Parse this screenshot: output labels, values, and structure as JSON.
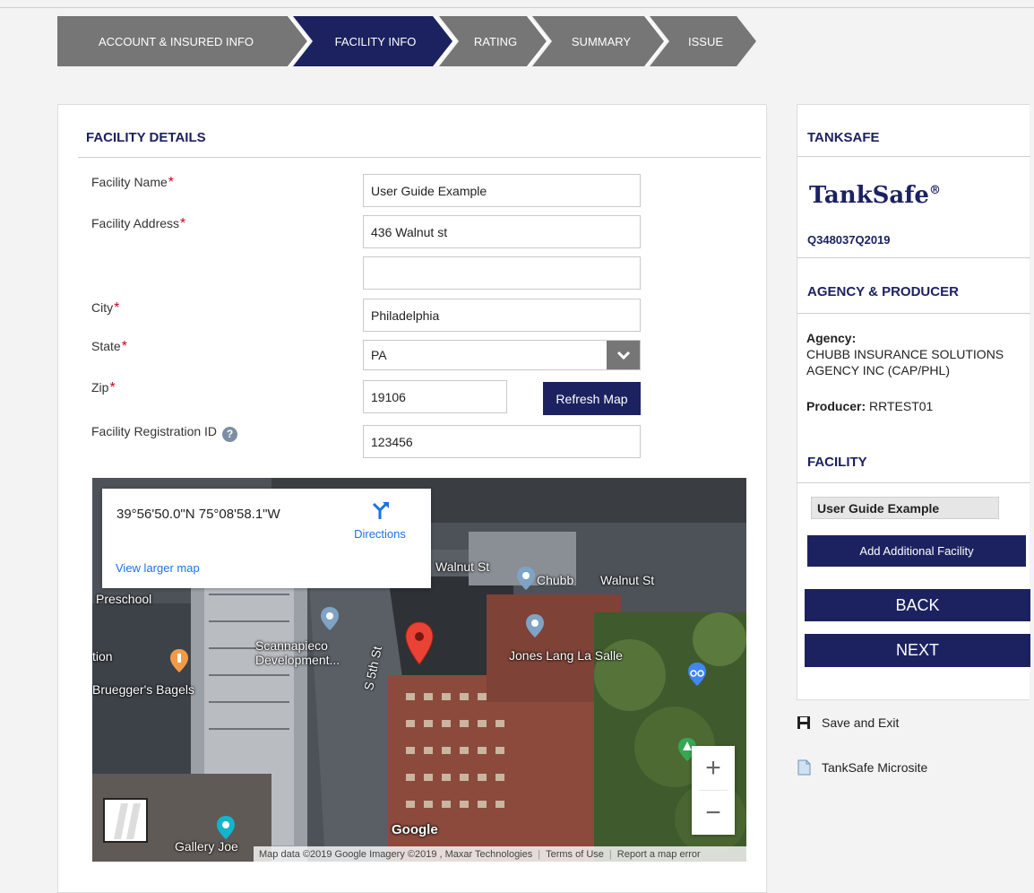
{
  "steps": [
    {
      "label": "ACCOUNT & INSURED INFO",
      "active": false
    },
    {
      "label": "FACILITY INFO",
      "active": true
    },
    {
      "label": "RATING",
      "active": false
    },
    {
      "label": "SUMMARY",
      "active": false
    },
    {
      "label": "ISSUE",
      "active": false
    }
  ],
  "facility": {
    "section_title": "FACILITY DETAILS",
    "required_mark": "*",
    "name_label": "Facility Name",
    "name_value": "User Guide Example",
    "address_label": "Facility Address",
    "address_value": "436 Walnut st",
    "address2_value": "",
    "city_label": "City",
    "city_value": "Philadelphia",
    "state_label": "State",
    "state_value": "PA",
    "zip_label": "Zip",
    "zip_value": "19106",
    "refresh_map": "Refresh Map",
    "reg_id_label": "Facility Registration ID",
    "help_glyph": "?",
    "reg_id_value": "123456"
  },
  "map": {
    "coords": "39°56'50.0\"N 75°08'58.1\"W",
    "directions": "Directions",
    "view_larger": "View larger map",
    "labels": [
      "Walnut St",
      "Chubb",
      "Walnut St",
      "Preschool",
      "Scannapieco Development...",
      "Jones Lang La Salle",
      "tion",
      "Bruegger's Bagels",
      "S 5th St",
      "Gallery Joe",
      "Google"
    ],
    "zoom_in": "+",
    "zoom_out": "−",
    "attribution": [
      "Map data ©2019 Google Imagery ©2019 , Maxar Technologies",
      "Terms of Use",
      "Report a map error"
    ]
  },
  "sidebar": {
    "tanksafe_title": "TANKSAFE",
    "logo_text": "TankSafe",
    "logo_mark": "®",
    "quote_number": "Q348037Q2019",
    "agency_title": "AGENCY & PRODUCER",
    "agency_label": "Agency:",
    "agency_name": "CHUBB INSURANCE SOLUTIONS AGENCY INC (CAP/PHL)",
    "producer_label": "Producer:",
    "producer_value": "RRTEST01",
    "facility_title": "FACILITY",
    "facility_item": "User Guide Example",
    "add_facility": "Add Additional Facility",
    "back": "BACK",
    "next": "NEXT"
  },
  "links": {
    "save_exit": "Save and Exit",
    "microsite": "TankSafe Microsite"
  },
  "colors": {
    "navy": "#1c2260",
    "gray_step": "#767676",
    "required": "#d0021b",
    "link_blue": "#1a73e8"
  }
}
